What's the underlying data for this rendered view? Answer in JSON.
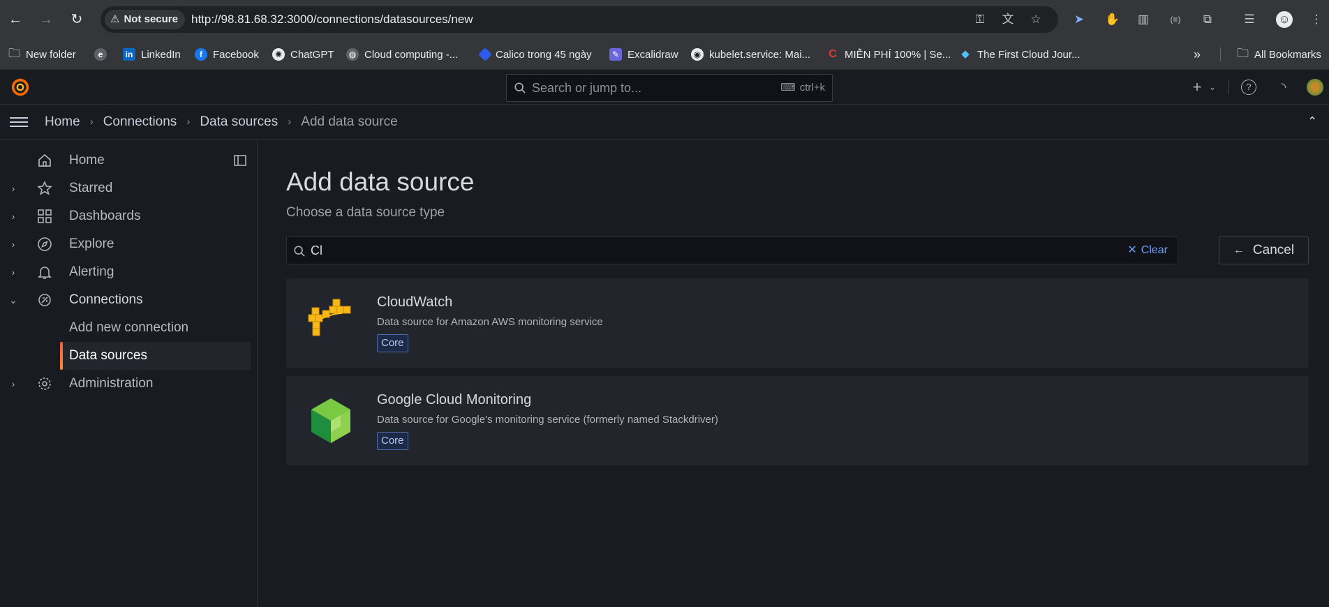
{
  "browser": {
    "security_label": "Not secure",
    "url": "http://98.81.68.32:3000/connections/datasources/new",
    "bookmarks": [
      {
        "label": "New folder",
        "icon": "folder-icon"
      },
      {
        "label": "",
        "icon": "globe-e-icon"
      },
      {
        "label": "LinkedIn",
        "icon": "linkedin-icon"
      },
      {
        "label": "Facebook",
        "icon": "facebook-icon"
      },
      {
        "label": "ChatGPT",
        "icon": "chatgpt-icon"
      },
      {
        "label": "Cloud computing -...",
        "icon": "globe-icon"
      },
      {
        "label": "Calico trong 45 ngày",
        "icon": "calico-icon"
      },
      {
        "label": "Excalidraw",
        "icon": "excalidraw-icon"
      },
      {
        "label": "kubelet.service: Mai...",
        "icon": "github-icon"
      },
      {
        "label": "MIỄN PHÍ 100% | Se...",
        "icon": "c-icon"
      },
      {
        "label": "The First Cloud Jour...",
        "icon": "diamond-icon"
      }
    ],
    "all_bookmarks_label": "All Bookmarks"
  },
  "grafana": {
    "search": {
      "placeholder": "Search or jump to...",
      "shortcut": "ctrl+k"
    },
    "breadcrumb": [
      "Home",
      "Connections",
      "Data sources",
      "Add data source"
    ],
    "nav": {
      "items": [
        {
          "label": "Home",
          "icon": "home-icon",
          "chevron": ""
        },
        {
          "label": "Starred",
          "icon": "star-icon",
          "chevron": "›"
        },
        {
          "label": "Dashboards",
          "icon": "apps-icon",
          "chevron": "›"
        },
        {
          "label": "Explore",
          "icon": "compass-icon",
          "chevron": "›"
        },
        {
          "label": "Alerting",
          "icon": "bell-icon",
          "chevron": "›"
        },
        {
          "label": "Connections",
          "icon": "plug-icon",
          "chevron": "⌄"
        },
        {
          "label": "Administration",
          "icon": "cog-icon",
          "chevron": "›"
        }
      ],
      "sub_items": [
        {
          "label": "Add new connection"
        },
        {
          "label": "Data sources"
        }
      ]
    },
    "main": {
      "title": "Add data source",
      "subtitle": "Choose a data source type",
      "search_value": "Cl",
      "clear_label": "Clear",
      "cancel_label": "Cancel",
      "results": [
        {
          "name": "CloudWatch",
          "description": "Data source for Amazon AWS monitoring service",
          "badge": "Core"
        },
        {
          "name": "Google Cloud Monitoring",
          "description": "Data source for Google's monitoring service (formerly named Stackdriver)",
          "badge": "Core"
        }
      ]
    }
  },
  "colors": {
    "accent": "#f55f3e",
    "link": "#6e9fff",
    "background": "#181b1f",
    "card": "#22252b"
  }
}
